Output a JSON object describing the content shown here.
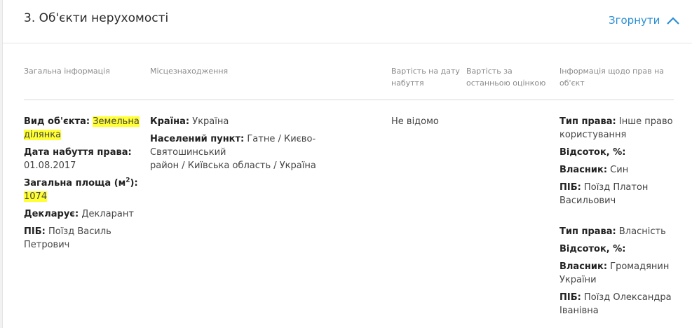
{
  "section": {
    "title": "3. Об'єкти нерухомості",
    "collapse_label": "Згорнути"
  },
  "table": {
    "headers": {
      "general": "Загальна інформація",
      "location": "Місцезнаходження",
      "cost_acq_line1": "Вартість на дату",
      "cost_acq_line2": "набуття",
      "cost_last_line1": "Вартість за",
      "cost_last_line2": "останньою оцінкою",
      "rights_line1": "Інформація щодо прав на",
      "rights_line2": "об'єкт"
    },
    "general": {
      "type_label": "Вид об'єкта:",
      "type_value_line1": "Земельна",
      "type_value_line2": "ділянка",
      "acq_date_label": "Дата набуття права:",
      "acq_date_value": "01.08.2017",
      "area_label_prefix": "Загальна площа (м",
      "area_label_sup": "2",
      "area_label_suffix": "):",
      "area_value": "1074",
      "declarant_label": "Декларує:",
      "declarant_value": "Декларант",
      "name_label": "ПІБ:",
      "name_value_line1": "Поїзд Василь",
      "name_value_line2": "Петрович"
    },
    "location": {
      "country_label": "Країна:",
      "country_value": "Україна",
      "settlement_label": "Населений пункт:",
      "settlement_value_line1": "Гатне / Києво-Святошинський",
      "settlement_value_line2": "район / Київська область / Україна"
    },
    "cost_acq": "Не відомо",
    "rights": [
      {
        "type_label": "Тип права:",
        "type_value_line1": "Інше право",
        "type_value_line2": "користування",
        "percent_label": "Відсоток, %:",
        "owner_label": "Власник:",
        "owner_value_line1": "Син",
        "owner_value_line2": "",
        "name_label": "ПІБ:",
        "name_value_line1": "Поїзд Платон",
        "name_value_line2": "Васильович"
      },
      {
        "type_label": "Тип права:",
        "type_value_line1": "Власність",
        "type_value_line2": "",
        "percent_label": "Відсоток, %:",
        "owner_label": "Власник:",
        "owner_value_line1": "Громадянин",
        "owner_value_line2": "України",
        "name_label": "ПІБ:",
        "name_value_line1": "Поїзд Олександра",
        "name_value_line2": "Іванівна"
      }
    ]
  }
}
